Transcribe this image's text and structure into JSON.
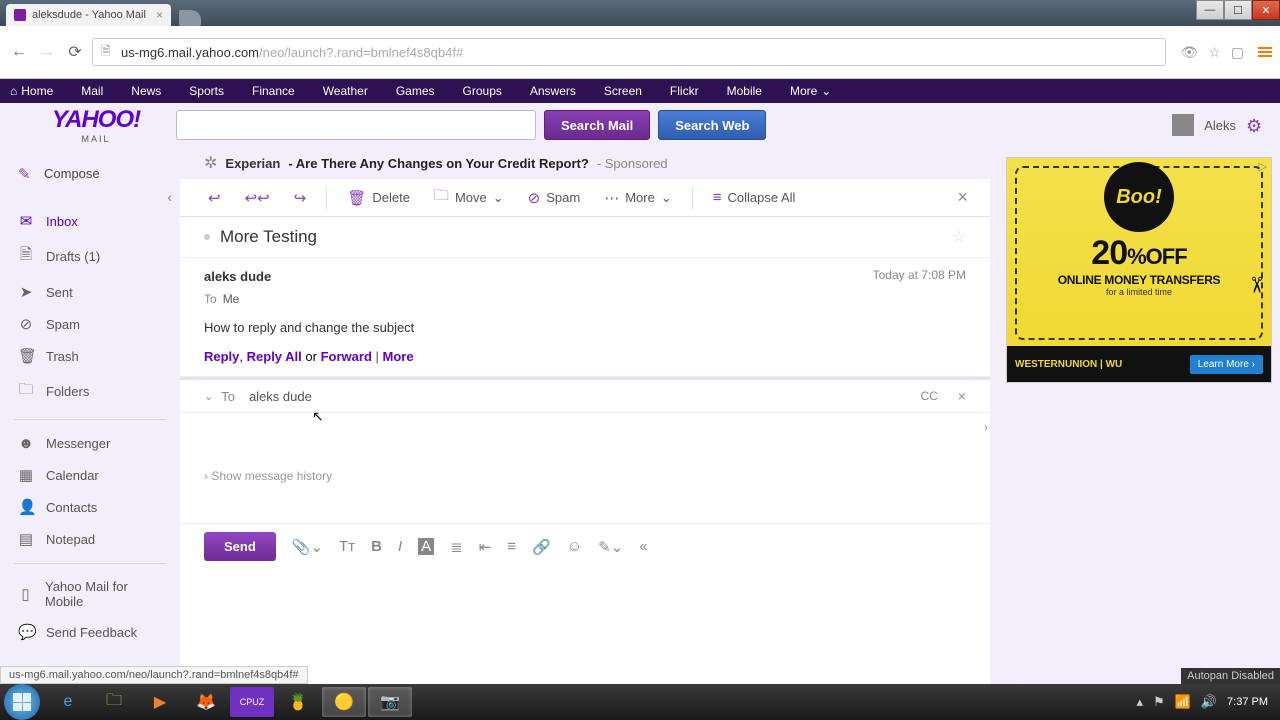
{
  "browser": {
    "tab_title": "aleksdude - Yahoo Mail",
    "url_domain": "us-mg6.mail.yahoo.com",
    "url_path": "/neo/launch?.rand=bmlnef4s8qb4f#",
    "status_hint": "us-mg6.mail.yahoo.com/neo/launch?.rand=bmlnef4s8qb4f#"
  },
  "yahoo_nav": [
    "Home",
    "Mail",
    "News",
    "Sports",
    "Finance",
    "Weather",
    "Games",
    "Groups",
    "Answers",
    "Screen",
    "Flickr",
    "Mobile",
    "More"
  ],
  "logo": {
    "main": "YAHOO!",
    "sub": "MAIL"
  },
  "search": {
    "mail_btn": "Search Mail",
    "web_btn": "Search Web"
  },
  "user": {
    "name": "Aleks"
  },
  "sidebar": {
    "compose": "Compose",
    "folders": [
      {
        "label": "Inbox",
        "icon": "✉"
      },
      {
        "label": "Drafts (1)",
        "icon": "📄"
      },
      {
        "label": "Sent",
        "icon": "➤"
      },
      {
        "label": "Spam",
        "icon": "⛉"
      },
      {
        "label": "Trash",
        "icon": "🗑"
      },
      {
        "label": "Folders",
        "icon": "🗀"
      }
    ],
    "apps": [
      {
        "label": "Messenger",
        "icon": "☻"
      },
      {
        "label": "Calendar",
        "icon": "▦"
      },
      {
        "label": "Contacts",
        "icon": "👤"
      },
      {
        "label": "Notepad",
        "icon": "▤"
      }
    ],
    "footer": [
      {
        "label": "Yahoo Mail for Mobile",
        "icon": "📱"
      },
      {
        "label": "Send Feedback",
        "icon": "💬"
      }
    ]
  },
  "ad_top": {
    "brand": "Experian",
    "text": "- Are There Any Changes on Your Credit Report?",
    "sponsored": "- Sponsored"
  },
  "toolbar": {
    "delete": "Delete",
    "move": "Move",
    "spam": "Spam",
    "more": "More",
    "collapse": "Collapse All"
  },
  "message": {
    "subject": "More Testing",
    "sender": "aleks dude",
    "date": "Today at 7:08 PM",
    "to_label": "To",
    "to_value": "Me",
    "body": "How to reply and change the subject",
    "actions": {
      "reply": "Reply",
      "reply_all": "Reply All",
      "or": "or",
      "forward": "Forward",
      "more": "More"
    }
  },
  "compose": {
    "to_label": "To",
    "to_value": "aleks dude",
    "cc": "CC",
    "show_history": "Show message history",
    "send": "Send"
  },
  "right_ad": {
    "boo": "Boo!",
    "big": "20",
    "pct": "%OFF",
    "line1": "ONLINE MONEY TRANSFERS",
    "line2": "for a limited time",
    "wu": "WESTERNUNION | WU",
    "learn": "Learn More ›"
  },
  "taskbar": {
    "time": "7:37 PM",
    "autopan": "Autopan Disabled"
  }
}
